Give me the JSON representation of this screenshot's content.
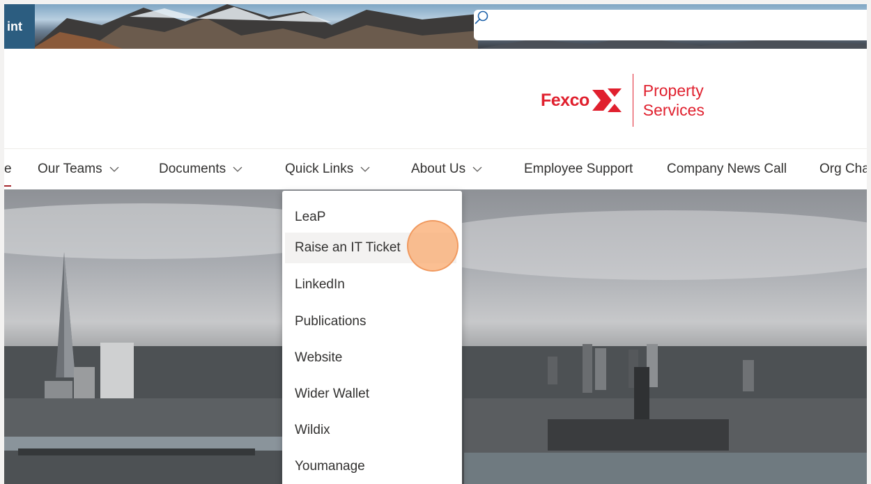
{
  "suite_bar": {
    "app_name": "int",
    "search_placeholder": ""
  },
  "header": {
    "logo_word": "Fexco",
    "logo_subtitle_line1": "Property",
    "logo_subtitle_line2": "Services",
    "brand_color": "#e0202e"
  },
  "nav": {
    "items": [
      {
        "label": "e",
        "has_dropdown": false,
        "active": true
      },
      {
        "label": "Our Teams",
        "has_dropdown": true
      },
      {
        "label": "Documents",
        "has_dropdown": true
      },
      {
        "label": "Quick Links",
        "has_dropdown": true
      },
      {
        "label": "About Us",
        "has_dropdown": true
      },
      {
        "label": "Employee Support",
        "has_dropdown": false
      },
      {
        "label": "Company News Call",
        "has_dropdown": false
      },
      {
        "label": "Org Cha",
        "has_dropdown": false
      }
    ]
  },
  "quick_links_menu": {
    "items": [
      {
        "label": "LeaP"
      },
      {
        "label": "Raise an IT Ticket",
        "hovered": true
      },
      {
        "label": "LinkedIn"
      },
      {
        "label": "Publications"
      },
      {
        "label": "Website"
      },
      {
        "label": "Wider Wallet"
      },
      {
        "label": "Wildix"
      },
      {
        "label": "Youmanage"
      }
    ]
  }
}
